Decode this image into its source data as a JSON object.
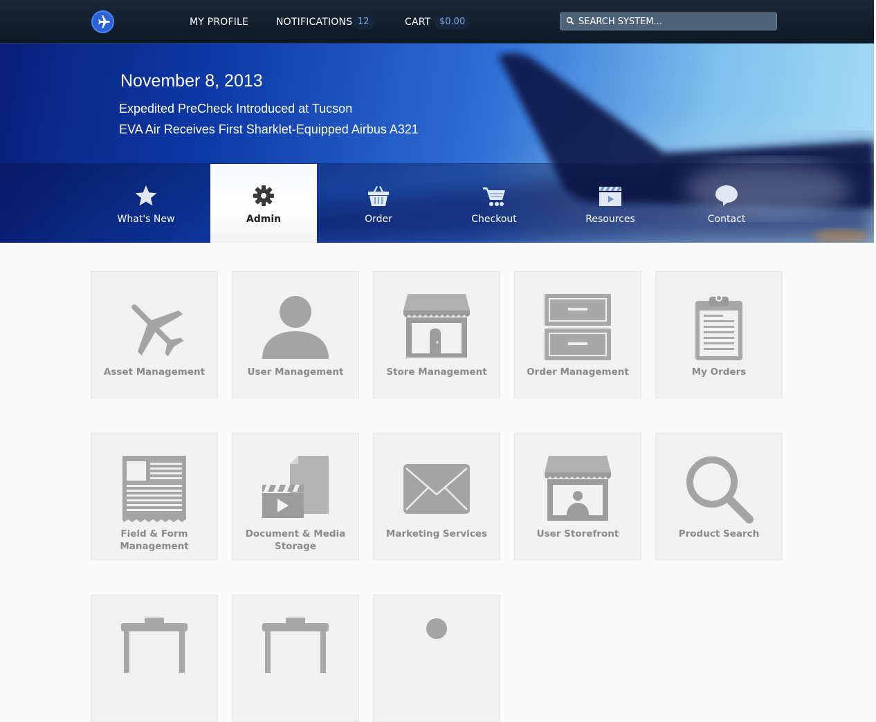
{
  "topbar": {
    "logo_icon": "airplane-icon",
    "nav": [
      {
        "label": "MY PROFILE"
      },
      {
        "label": "NOTIFICATIONS",
        "badge": "12"
      },
      {
        "label": "CART",
        "badge": "$0.00"
      }
    ],
    "search": {
      "placeholder": "SEARCH SYSTEM...",
      "icon": "search-icon"
    }
  },
  "hero": {
    "date": "November 8, 2013",
    "headlines": [
      "Expedited PreCheck Introduced at Tucson",
      "EVA Air Receives First Sharklet-Equipped Airbus A321"
    ]
  },
  "tabs": [
    {
      "label": "What's New",
      "icon": "star-icon"
    },
    {
      "label": "Admin",
      "icon": "gear-icon",
      "active": true
    },
    {
      "label": "Order",
      "icon": "basket-icon"
    },
    {
      "label": "Checkout",
      "icon": "cart-icon"
    },
    {
      "label": "Resources",
      "icon": "clapperboard-icon"
    },
    {
      "label": "Contact",
      "icon": "speech-bubble-icon"
    }
  ],
  "tiles": [
    {
      "label": "Asset Management",
      "icon": "airplane-icon"
    },
    {
      "label": "User Management",
      "icon": "user-icon"
    },
    {
      "label": "Store Management",
      "icon": "storefront-icon"
    },
    {
      "label": "Order Management",
      "icon": "file-cabinet-icon"
    },
    {
      "label": "My Orders",
      "icon": "clipboard-icon"
    },
    {
      "label_line1": "Field & Form",
      "label_line2": "Management",
      "icon": "form-document-icon"
    },
    {
      "label_line1": "Document & Media",
      "label_line2": "Storage",
      "icon": "media-documents-icon"
    },
    {
      "label": "Marketing Services",
      "icon": "envelope-icon"
    },
    {
      "label": "User Storefront",
      "icon": "user-storefront-icon"
    },
    {
      "label": "Product Search",
      "icon": "magnifier-icon"
    },
    {
      "icon": "table-icon"
    },
    {
      "icon": "table-icon"
    },
    {
      "icon": "user-icon"
    }
  ],
  "colors": {
    "topbar": "#12202f",
    "accent": "#2a63d8",
    "tile_bg": "#f1f1f1",
    "tile_icon": "#9a9a9a",
    "tile_text": "#8a8a8a"
  }
}
